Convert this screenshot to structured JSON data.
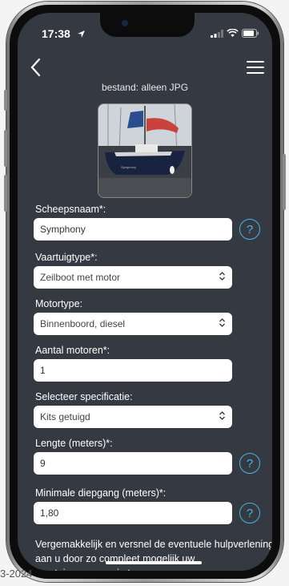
{
  "status_bar": {
    "time": "17:38"
  },
  "header": {
    "file_hint": "bestand: alleen JPG"
  },
  "fields": {
    "ship_name": {
      "label": "Scheepsnaam*:",
      "value": "Symphony",
      "help": "?"
    },
    "vessel_type": {
      "label": "Vaartuigtype*:",
      "value": "Zeilboot met motor"
    },
    "engine_type": {
      "label": "Motortype:",
      "value": "Binnenboord, diesel"
    },
    "engine_count": {
      "label": "Aantal motoren*:",
      "value": "1"
    },
    "specification": {
      "label": "Selecteer specificatie:",
      "value": "Kits getuigd"
    },
    "length": {
      "label": "Lengte (meters)*:",
      "value": "9",
      "help": "?"
    },
    "draft": {
      "label": "Minimale diepgang (meters)*:",
      "value": "1,80",
      "help": "?"
    }
  },
  "info_text": "Vergemakkelijk en versnel de eventuele hulpverlening aan u door zo compleet mogelijk uw vaartuiggegevens in te voeren",
  "watermark": "3-2024",
  "colors": {
    "screen_bg": "#353941",
    "help_accent": "#4db3e6"
  }
}
